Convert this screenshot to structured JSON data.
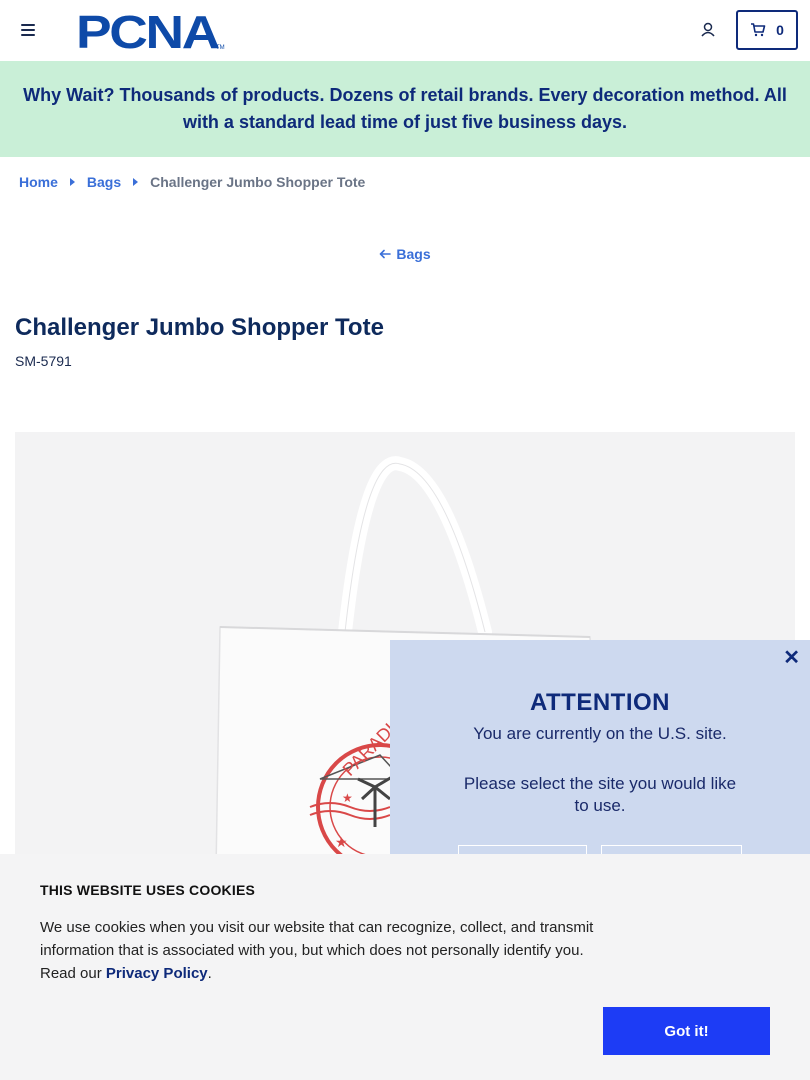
{
  "header": {
    "logo_text": "PCNA",
    "cart_count": "0"
  },
  "promo": {
    "text": "Why Wait? Thousands of products. Dozens of retail brands. Every decoration method. All with a standard lead time of just five business days."
  },
  "breadcrumb": {
    "items": [
      "Home",
      "Bags"
    ],
    "current": "Challenger Jumbo Shopper Tote"
  },
  "back_link": {
    "label": "Bags"
  },
  "product": {
    "title": "Challenger Jumbo Shopper Tote",
    "sku": "SM-5791",
    "print_text": "PARADISE"
  },
  "attention": {
    "title": "ATTENTION",
    "line1": "You are currently on the U.S. site.",
    "line2": "Please select the site you would like to use."
  },
  "cookie": {
    "title": "THIS WEBSITE USES COOKIES",
    "text": "We use cookies when you visit our website that can recognize, collect, and transmit information that is associated with you, but which does not personally identify you. Read our",
    "link": "Privacy Policy",
    "period": ".",
    "button": "Got it!"
  },
  "colors": {
    "brand_navy": "#0e2a7a",
    "promo_bg": "#c9efd7",
    "link_blue": "#3a6fd8",
    "attention_bg": "#cdd9ef",
    "cookie_button": "#1d3cf5"
  }
}
